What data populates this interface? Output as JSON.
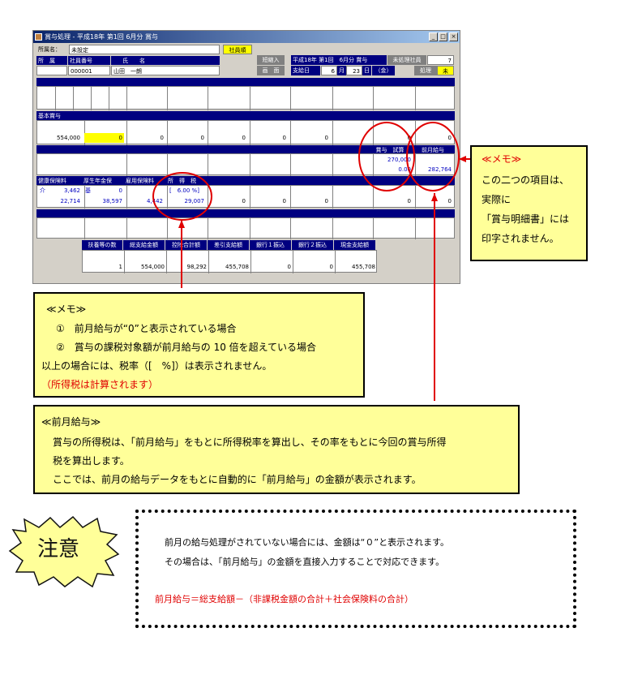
{
  "window": {
    "title": "賞与処理 - 平成18年 第1回 6月分 賞与",
    "btn_min": "_",
    "btn_max": "□",
    "btn_close": "×"
  },
  "header": {
    "shozoku_label": "所属名：",
    "shozoku_value": "未設定",
    "sort_button": "社員順",
    "col_shozoku": "所　属",
    "col_emp_no": "社員番号",
    "col_name": "氏　　名",
    "emp_no": "000001",
    "emp_name": "山田　一朗",
    "btn_short_input": "短縮入",
    "btn_screen": "画　面",
    "period": "平成18年 第1回　6月分 賞与",
    "unprocessed_label": "未処理社員",
    "unprocessed_count": "7",
    "payday_label": "支給日",
    "pay_month": "6",
    "month_unit": "月",
    "pay_day": "23",
    "day_unit": "日",
    "weekday": "（金）",
    "process_label": "処理",
    "process_status": "未"
  },
  "sections": {
    "basic_bonus": "基本賞与",
    "basic_values": [
      "554,000",
      "0",
      "0",
      "0",
      "0",
      "0",
      "0",
      "0",
      "0"
    ],
    "bonus_label": "賞与　試算",
    "prev_salary_label": "前月給与",
    "bonus_trial_value": "270,000",
    "rate_value": "0.00",
    "prev_salary_value": "282,764",
    "deduction_headers": [
      "健康保険料",
      "厚生年金保",
      "雇用保険料",
      "所　得　税"
    ],
    "kaigo_label": "介",
    "kaigo_value": "3,462",
    "ki_label": "基",
    "ki_value": "0",
    "tax_rate": "[　6.00 %]",
    "deduction_values": [
      "22,714",
      "38,597",
      "4,442",
      "29,007",
      "0",
      "0",
      "0",
      "0",
      "0"
    ],
    "summary_headers": [
      "扶養等の数",
      "総支給金額",
      "控除合計額",
      "差引支給額",
      "銀行１振込",
      "銀行２振込",
      "現金支給額"
    ],
    "summary_values": [
      "1",
      "554,000",
      "98,292",
      "455,708",
      "0",
      "0",
      "455,708"
    ]
  },
  "memo_right": {
    "title": "≪メモ≫",
    "lines": [
      "この二つの項目は、",
      "実際に",
      "「賞与明細書」には",
      "印字されません。"
    ]
  },
  "memo_tax": {
    "title": "≪メモ≫",
    "line1": "①　前月給与が“0”と表示されている場合",
    "line2": "②　賞与の課税対象額が前月給与の 10 倍を超えている場合",
    "line3": "以上の場合には、税率（[　%]）は表示されません。",
    "line4": "（所得税は計算されます）"
  },
  "memo_prev": {
    "title": "≪前月給与≫",
    "line1": "賞与の所得税は、「前月給与」をもとに所得税率を算出し、その率をもとに今回の賞与所得",
    "line2": "税を算出します。",
    "line3": "ここでは、前月の給与データをもとに自動的に「前月給与」の金額が表示されます。"
  },
  "caution": {
    "badge": "注意",
    "line1": "前月の給与処理がされていない場合には、金額は“０”と表示されます。",
    "line2": "その場合は、「前月給与」の金額を直接入力することで対応できます。",
    "formula": "前月給与＝総支給額－（非課税金額の合計＋社会保険料の合計）"
  },
  "colors": {
    "navy": "#000080",
    "memo_bg": "#ffff99",
    "annotation_red": "#e00000",
    "highlight_yellow": "#ffff00"
  }
}
